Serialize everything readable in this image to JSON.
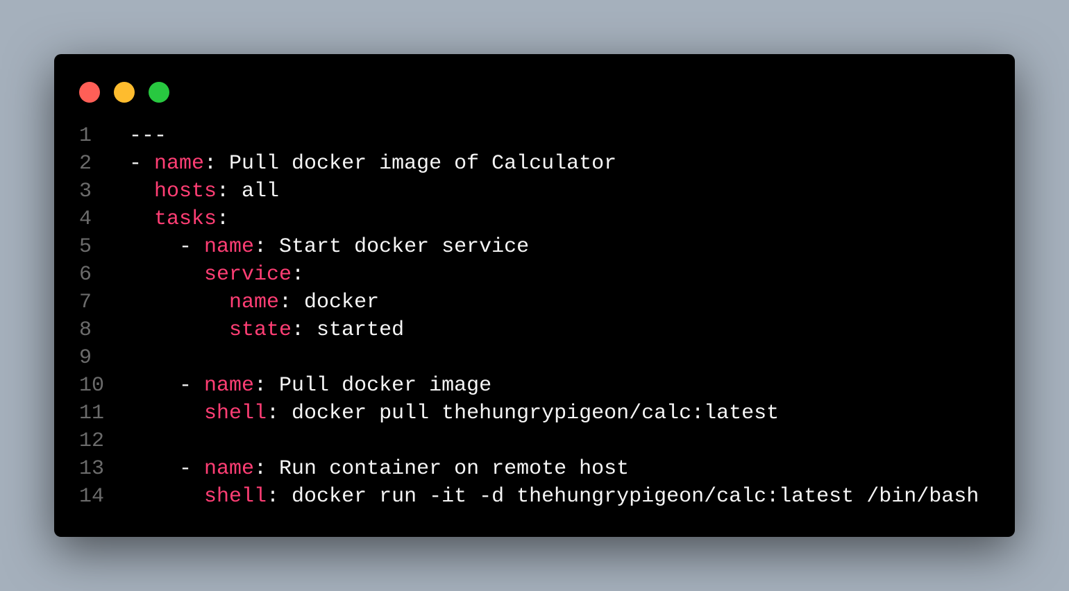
{
  "window": {
    "controls": [
      {
        "name": "close",
        "color": "#ff5f57"
      },
      {
        "name": "minimize",
        "color": "#febc2e"
      },
      {
        "name": "maximize",
        "color": "#28c840"
      }
    ]
  },
  "colors": {
    "key": "#ff3e74",
    "text": "#f5f5f5",
    "line_number": "#6b6b6b",
    "background": "#000000"
  },
  "code": {
    "language": "yaml",
    "lines": [
      {
        "number": "1",
        "indent": "",
        "key": "",
        "text": "---"
      },
      {
        "number": "2",
        "indent": "- ",
        "key": "name",
        "text": ": Pull docker image of Calculator"
      },
      {
        "number": "3",
        "indent": "  ",
        "key": "hosts",
        "text": ": all"
      },
      {
        "number": "4",
        "indent": "  ",
        "key": "tasks",
        "text": ":"
      },
      {
        "number": "5",
        "indent": "    - ",
        "key": "name",
        "text": ": Start docker service"
      },
      {
        "number": "6",
        "indent": "      ",
        "key": "service",
        "text": ":"
      },
      {
        "number": "7",
        "indent": "        ",
        "key": "name",
        "text": ": docker"
      },
      {
        "number": "8",
        "indent": "        ",
        "key": "state",
        "text": ": started"
      },
      {
        "number": "9",
        "indent": "",
        "key": "",
        "text": ""
      },
      {
        "number": "10",
        "indent": "    - ",
        "key": "name",
        "text": ": Pull docker image"
      },
      {
        "number": "11",
        "indent": "      ",
        "key": "shell",
        "text": ": docker pull thehungrypigeon/calc:latest"
      },
      {
        "number": "12",
        "indent": "",
        "key": "",
        "text": ""
      },
      {
        "number": "13",
        "indent": "    - ",
        "key": "name",
        "text": ": Run container on remote host"
      },
      {
        "number": "14",
        "indent": "      ",
        "key": "shell",
        "text": ": docker run -it -d thehungrypigeon/calc:latest /bin/bash"
      }
    ]
  }
}
